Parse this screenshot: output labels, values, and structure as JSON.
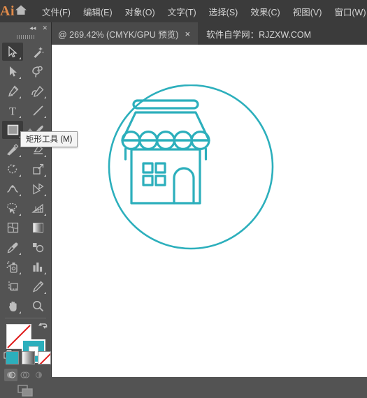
{
  "app": {
    "logo_text": "Ai",
    "home_icon": "home-icon"
  },
  "menubar": {
    "items": [
      {
        "label": "文件(F)",
        "name": "menu-file"
      },
      {
        "label": "编辑(E)",
        "name": "menu-edit"
      },
      {
        "label": "对象(O)",
        "name": "menu-object"
      },
      {
        "label": "文字(T)",
        "name": "menu-type"
      },
      {
        "label": "选择(S)",
        "name": "menu-select"
      },
      {
        "label": "效果(C)",
        "name": "menu-effect"
      },
      {
        "label": "视图(V)",
        "name": "menu-view"
      },
      {
        "label": "窗口(W)",
        "name": "menu-window"
      }
    ]
  },
  "tabs": {
    "document": {
      "label": "@ 269.42% (CMYK/GPU 预览)",
      "close_label": "×"
    },
    "site": {
      "label": "软件自学网：RJZXW.COM"
    }
  },
  "tool_panel": {
    "collapse_label": "◂◂",
    "close_label": "✕",
    "tools": [
      {
        "name": "selection-tool",
        "label": "选择工具",
        "selected": true,
        "corner": true
      },
      {
        "name": "magic-wand-tool",
        "label": "魔棒工具",
        "selected": false,
        "corner": false
      },
      {
        "name": "direct-selection-tool",
        "label": "直接选择工具",
        "selected": false,
        "corner": true
      },
      {
        "name": "lasso-tool",
        "label": "套索工具",
        "selected": false,
        "corner": false
      },
      {
        "name": "pen-tool",
        "label": "钢笔工具",
        "selected": false,
        "corner": true
      },
      {
        "name": "curvature-tool",
        "label": "曲率工具",
        "selected": false,
        "corner": true
      },
      {
        "name": "type-tool",
        "label": "文字工具",
        "selected": false,
        "corner": true
      },
      {
        "name": "line-segment-tool",
        "label": "直线段工具",
        "selected": false,
        "corner": true
      },
      {
        "name": "rectangle-tool",
        "label": "矩形工具",
        "selected": true,
        "corner": true
      },
      {
        "name": "paintbrush-tool",
        "label": "画笔工具",
        "selected": false,
        "corner": true
      },
      {
        "name": "shaper-tool",
        "label": "Shaper 工具",
        "selected": false,
        "corner": true
      },
      {
        "name": "eraser-tool",
        "label": "橡皮擦工具",
        "selected": false,
        "corner": true
      },
      {
        "name": "rotate-tool",
        "label": "旋转工具",
        "selected": false,
        "corner": true
      },
      {
        "name": "scale-tool",
        "label": "比例缩放工具",
        "selected": false,
        "corner": true
      },
      {
        "name": "width-tool",
        "label": "宽度工具",
        "selected": false,
        "corner": true
      },
      {
        "name": "free-transform-tool",
        "label": "自由变换工具",
        "selected": false,
        "corner": true
      },
      {
        "name": "shape-builder-tool",
        "label": "形状生成器工具",
        "selected": false,
        "corner": true
      },
      {
        "name": "perspective-grid-tool",
        "label": "透视网格工具",
        "selected": false,
        "corner": true
      },
      {
        "name": "mesh-tool",
        "label": "网格工具",
        "selected": false,
        "corner": false
      },
      {
        "name": "gradient-tool",
        "label": "渐变工具",
        "selected": false,
        "corner": false
      },
      {
        "name": "eyedropper-tool",
        "label": "吸管工具",
        "selected": false,
        "corner": true
      },
      {
        "name": "blend-tool",
        "label": "混合工具",
        "selected": false,
        "corner": false
      },
      {
        "name": "symbol-sprayer-tool",
        "label": "符号喷枪工具",
        "selected": false,
        "corner": true
      },
      {
        "name": "column-graph-tool",
        "label": "柱形图工具",
        "selected": false,
        "corner": true
      },
      {
        "name": "artboard-tool",
        "label": "画板工具",
        "selected": false,
        "corner": false
      },
      {
        "name": "slice-tool",
        "label": "切片工具",
        "selected": false,
        "corner": true
      },
      {
        "name": "hand-tool",
        "label": "抓手工具",
        "selected": false,
        "corner": true
      },
      {
        "name": "zoom-tool",
        "label": "缩放工具",
        "selected": false,
        "corner": false
      }
    ]
  },
  "tooltip": {
    "text": "矩形工具 (M)",
    "visible": true
  },
  "color_controls": {
    "fill": {
      "name": "fill-swatch",
      "value": "none"
    },
    "stroke": {
      "name": "stroke-swatch",
      "value": "#2cafbc"
    },
    "swap_name": "swap-fill-stroke-icon",
    "default_name": "default-fill-stroke-icon",
    "modes": [
      {
        "name": "color-mode-button",
        "type": "color",
        "value": "#2cafbc"
      },
      {
        "name": "gradient-mode-button",
        "type": "gradient",
        "value": "#ffffff"
      },
      {
        "name": "none-mode-button",
        "type": "none",
        "value": "none"
      }
    ],
    "draw_modes": [
      {
        "name": "draw-normal-button",
        "active": true
      },
      {
        "name": "draw-behind-button",
        "active": false
      },
      {
        "name": "draw-inside-button",
        "active": false
      }
    ],
    "screen_mode_name": "change-screen-mode-button"
  },
  "artwork": {
    "name": "shop-storefront-icon",
    "stroke_color": "#2cafbc",
    "description": "线性店铺图标：圆环内含带遮阳篷的店面",
    "parts": [
      {
        "name": "outer-circle"
      },
      {
        "name": "awning-top-bar"
      },
      {
        "name": "awning-canopy"
      },
      {
        "name": "awning-scallops"
      },
      {
        "name": "shop-body"
      },
      {
        "name": "window-panes"
      },
      {
        "name": "arched-door"
      },
      {
        "name": "left-post"
      },
      {
        "name": "right-post"
      }
    ]
  }
}
